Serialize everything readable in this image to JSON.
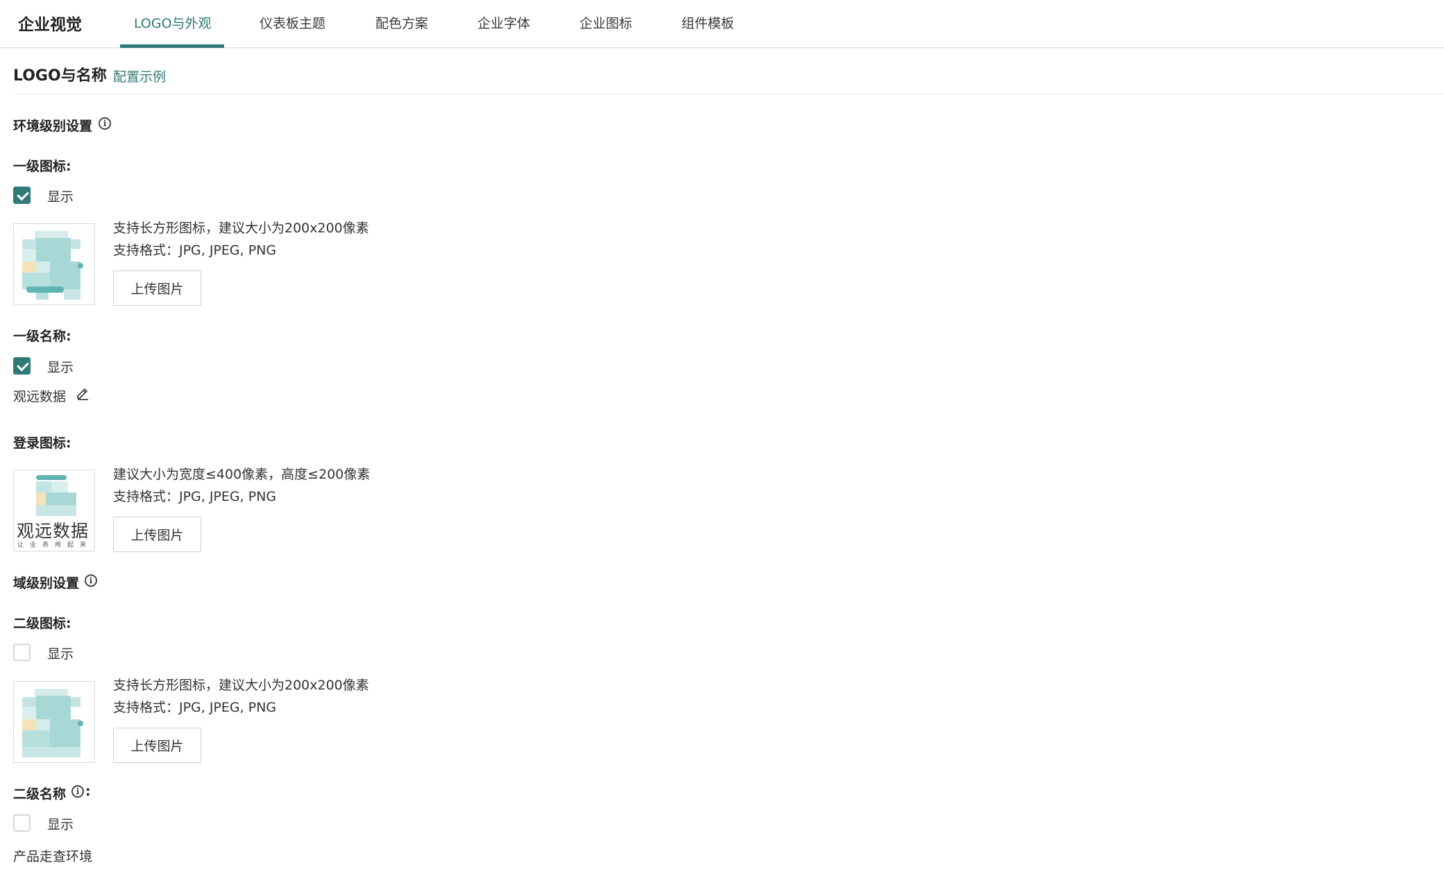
{
  "header": {
    "brand": "企业视觉",
    "tabs": [
      {
        "label": "LOGO与外观",
        "active": true
      },
      {
        "label": "仪表板主题",
        "active": false
      },
      {
        "label": "配色方案",
        "active": false
      },
      {
        "label": "企业字体",
        "active": false
      },
      {
        "label": "企业图标",
        "active": false
      },
      {
        "label": "组件模板",
        "active": false
      }
    ]
  },
  "section": {
    "title": "LOGO与名称",
    "config_link": "配置示例"
  },
  "env": {
    "title": "环境级别设置",
    "primary_icon": {
      "label": "一级图标:",
      "show_label": "显示",
      "checked": true,
      "hint1": "支持长方形图标，建议大小为200x200像素",
      "hint2": "支持格式：JPG, JPEG, PNG",
      "upload_label": "上传图片"
    },
    "primary_name": {
      "label": "一级名称:",
      "show_label": "显示",
      "checked": true,
      "value": "观远数据"
    },
    "login_icon": {
      "label": "登录图标:",
      "hint1": "建议大小为宽度≤400像素，高度≤200像素",
      "hint2": "支持格式：JPG, JPEG, PNG",
      "upload_label": "上传图片",
      "logo_text": "观远数据",
      "logo_slogan": "让业务用起来"
    }
  },
  "domain": {
    "title": "域级别设置",
    "secondary_icon": {
      "label": "二级图标:",
      "show_label": "显示",
      "checked": false,
      "hint1": "支持长方形图标，建议大小为200x200像素",
      "hint2": "支持格式：JPG, JPEG, PNG",
      "upload_label": "上传图片"
    },
    "secondary_name": {
      "label": "二级名称",
      "label_suffix": ":",
      "show_label": "显示",
      "checked": false,
      "value": "产品走查环境"
    }
  },
  "colors": {
    "accent": "#2f7a76",
    "logo_teal": "#a8d8d6",
    "logo_dark_teal": "#5fb4b1",
    "logo_yellow": "#f6e2b8"
  }
}
